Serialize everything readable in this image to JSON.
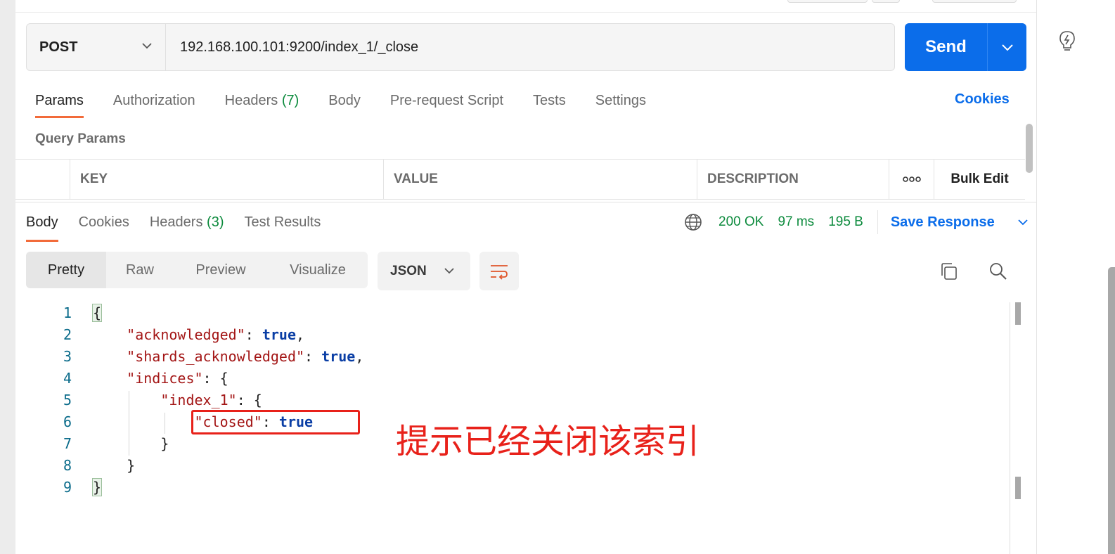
{
  "request": {
    "method": "POST",
    "url": "192.168.100.101:9200/index_1/_close",
    "send_label": "Send"
  },
  "request_tabs": [
    {
      "label": "Params",
      "count": "",
      "active": true
    },
    {
      "label": "Authorization",
      "count": ""
    },
    {
      "label": "Headers",
      "count": "(7)"
    },
    {
      "label": "Body",
      "count": ""
    },
    {
      "label": "Pre-request Script",
      "count": ""
    },
    {
      "label": "Tests",
      "count": ""
    },
    {
      "label": "Settings",
      "count": ""
    }
  ],
  "cookies_link": "Cookies",
  "query_params": {
    "title": "Query Params",
    "columns": [
      "KEY",
      "VALUE",
      "DESCRIPTION"
    ],
    "more_label": "ooo",
    "bulk_edit": "Bulk Edit"
  },
  "response_tabs": [
    {
      "label": "Body",
      "count": "",
      "active": true
    },
    {
      "label": "Cookies",
      "count": ""
    },
    {
      "label": "Headers",
      "count": "(3)"
    },
    {
      "label": "Test Results",
      "count": ""
    }
  ],
  "response_status": {
    "status": "200 OK",
    "time": "97 ms",
    "size": "195 B",
    "save_label": "Save Response"
  },
  "view_modes": [
    "Pretty",
    "Raw",
    "Preview",
    "Visualize"
  ],
  "format": "JSON",
  "code": {
    "line_numbers": [
      "1",
      "2",
      "3",
      "4",
      "5",
      "6",
      "7",
      "8",
      "9"
    ],
    "lines": {
      "l1": "{",
      "l2_key": "\"acknowledged\"",
      "l2_val": "true",
      "l3_key": "\"shards_acknowledged\"",
      "l3_val": "true",
      "l4_key": "\"indices\"",
      "l5_key": "\"index_1\"",
      "l6_key": "\"closed\"",
      "l6_val": "true",
      "l7": "}",
      "l8": "}",
      "l9": "}"
    }
  },
  "annotation": "提示已经关闭该索引",
  "colors": {
    "accent": "#0b6dea",
    "tab_underline": "#f26b3a",
    "status_green": "#0b8a3c",
    "annotation_red": "#e8211a"
  },
  "icons": [
    "chevron-down-icon",
    "globe-icon",
    "wrap-lines-icon",
    "copy-icon",
    "search-icon",
    "lightbulb-icon"
  ]
}
